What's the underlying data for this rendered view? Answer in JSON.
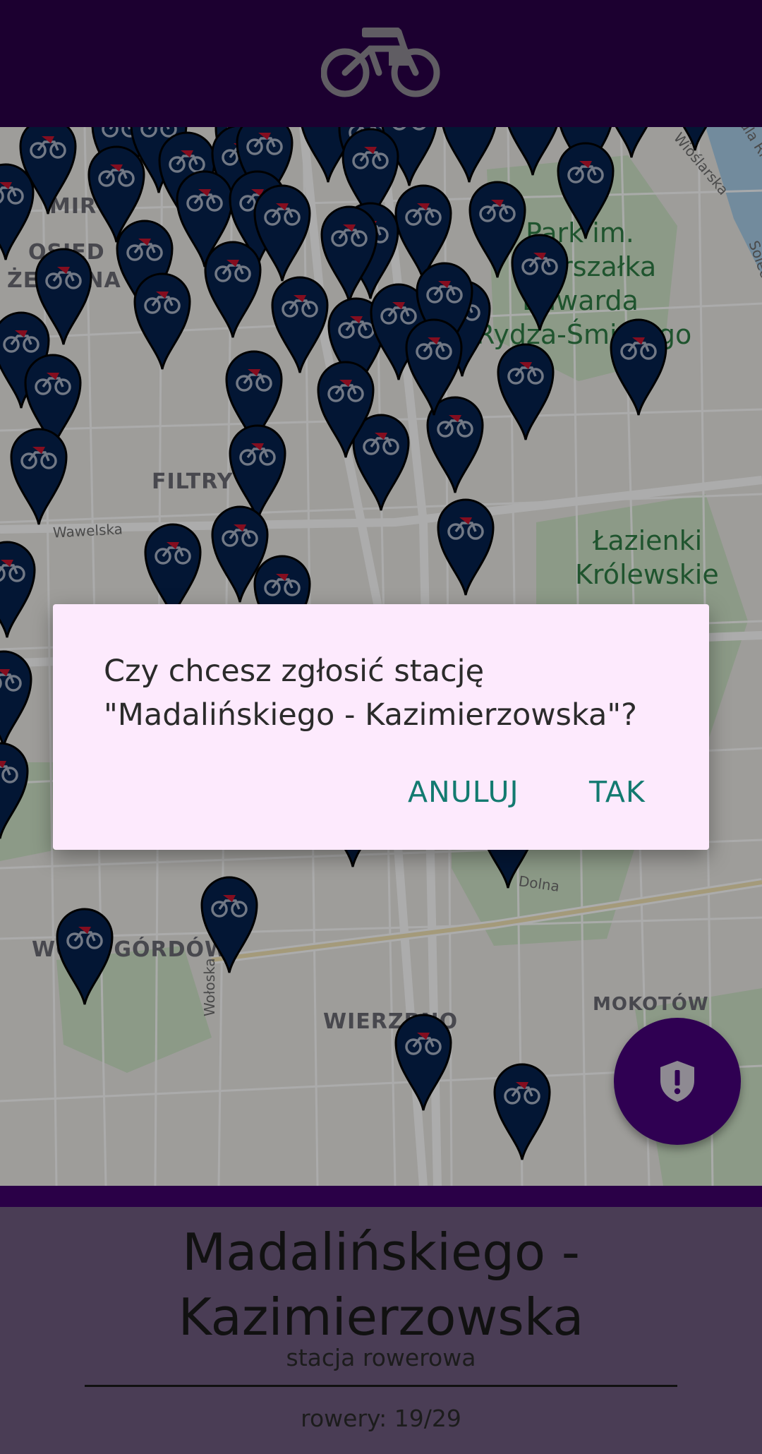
{
  "app": {
    "logo_icon": "bicycle-icon",
    "header_color": "#2a0047",
    "accent_color": "#137a70"
  },
  "map": {
    "district_labels": [
      "MIR",
      "OSIED",
      "ŻELAZNA",
      "FILTRY",
      "WIERZBNO",
      "MOKOTÓW",
      "WOLA GÓRDÓW"
    ],
    "park_labels": [
      "Park im.",
      "Marszałka",
      "Edwarda",
      "Rydza-Śmigłego",
      "Łazienki",
      "Królewskie"
    ],
    "streets": [
      "Wawelska",
      "Wołoska",
      "Dolna",
      "Wioślarska",
      "Solec",
      "Vistula River"
    ],
    "marker_icon": "bike-station-pin-icon"
  },
  "dialog": {
    "message_line1": "Czy chcesz zgłosić stację",
    "message_line2": "\"Madalińskiego - Kazimierzowska\"?",
    "cancel_label": "ANULUJ",
    "confirm_label": "TAK"
  },
  "fab": {
    "icon": "shield-alert-icon"
  },
  "station": {
    "name_line1": "Madalińskiego -",
    "name_line2": "Kazimierzowska",
    "type": "stacja rowerowa",
    "bikes": "rowery: 19/29"
  }
}
